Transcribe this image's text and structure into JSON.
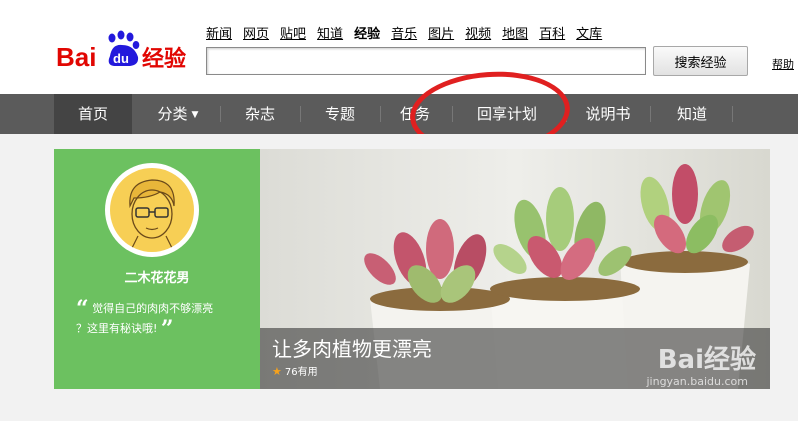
{
  "logo": {
    "text_bai": "Bai",
    "text_du": "du",
    "text_jingyan": "经验"
  },
  "top_nav": [
    {
      "label": "新闻",
      "active": false
    },
    {
      "label": "网页",
      "active": false
    },
    {
      "label": "贴吧",
      "active": false
    },
    {
      "label": "知道",
      "active": false
    },
    {
      "label": "经验",
      "active": true
    },
    {
      "label": "音乐",
      "active": false
    },
    {
      "label": "图片",
      "active": false
    },
    {
      "label": "视频",
      "active": false
    },
    {
      "label": "地图",
      "active": false
    },
    {
      "label": "百科",
      "active": false
    },
    {
      "label": "文库",
      "active": false
    }
  ],
  "search": {
    "value": "",
    "button_label": "搜索经验",
    "help_label": "帮助"
  },
  "main_nav": [
    {
      "label": "首页",
      "active": true
    },
    {
      "label": "分类",
      "dropdown": true
    },
    {
      "label": "杂志"
    },
    {
      "label": "专题"
    },
    {
      "label": "任务"
    },
    {
      "label": "回享计划"
    },
    {
      "label": "说明书"
    },
    {
      "label": "知道"
    }
  ],
  "feature": {
    "author": "二木花花男",
    "quote_line1": "觉得自己的肉肉不够漂亮",
    "quote_line2": "？这里有秘诀哦!",
    "title": "让多肉植物更漂亮",
    "useful_count": "76有用",
    "watermark": "Bai经验",
    "watermark_url": "jingyan.baidu.com"
  },
  "colors": {
    "brand_red": "#e10602",
    "brand_blue": "#2319dc",
    "nav_bg": "#5b5b5b",
    "card_green": "#6cc160",
    "annotation_red": "#e02020"
  }
}
